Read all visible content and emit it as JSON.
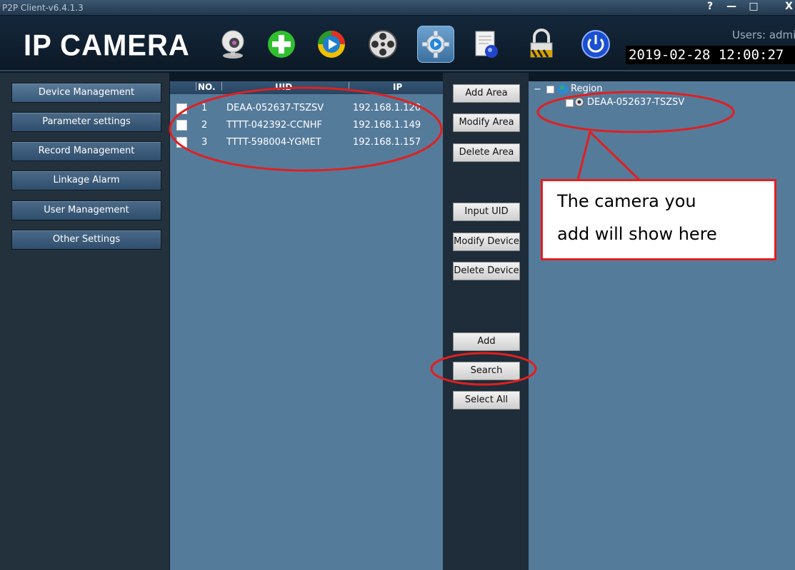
{
  "window": {
    "title": "P2P Client-v6.4.1.3",
    "help_label": "?",
    "minimize_label": "—",
    "maximize_label": "□",
    "close_label": "X"
  },
  "header": {
    "logo_text": "IP CAMERA",
    "users_text": "Users: admi",
    "clock": "2019-02-28 12:00:27",
    "tools": [
      "webcam-icon",
      "add-plus-icon",
      "playback-icon",
      "film-reel-icon",
      "settings-gear-icon",
      "log-document-icon",
      "lock-icon",
      "power-icon"
    ]
  },
  "sidebar": {
    "items": [
      {
        "label": "Device Management"
      },
      {
        "label": "Parameter settings"
      },
      {
        "label": "Record Management"
      },
      {
        "label": "Linkage Alarm"
      },
      {
        "label": "User Management"
      },
      {
        "label": "Other Settings"
      }
    ]
  },
  "device_list": {
    "columns": [
      "NO.",
      "UID",
      "IP"
    ],
    "rows": [
      {
        "no": "1",
        "uid": "DEAA-052637-TSZSV",
        "ip": "192.168.1.120"
      },
      {
        "no": "2",
        "uid": "TTTT-042392-CCNHF",
        "ip": "192.168.1.149"
      },
      {
        "no": "3",
        "uid": "TTTT-598004-YGMET",
        "ip": "192.168.1.157"
      }
    ]
  },
  "actions": {
    "add_area": "Add Area",
    "modify_area": "Modify Area",
    "delete_area": "Delete Area",
    "input_uid": "Input UID",
    "modify_device": "Modify Device",
    "delete_device": "Delete Device",
    "add": "Add",
    "search": "Search",
    "select_all": "Select All"
  },
  "tree": {
    "root_label": "Region",
    "collapse_symbol": "−",
    "device_label": "DEAA-052637-TSZSV"
  },
  "annotation": {
    "line1": "The camera you",
    "line2": "add will show here",
    "color": "#e02020"
  }
}
